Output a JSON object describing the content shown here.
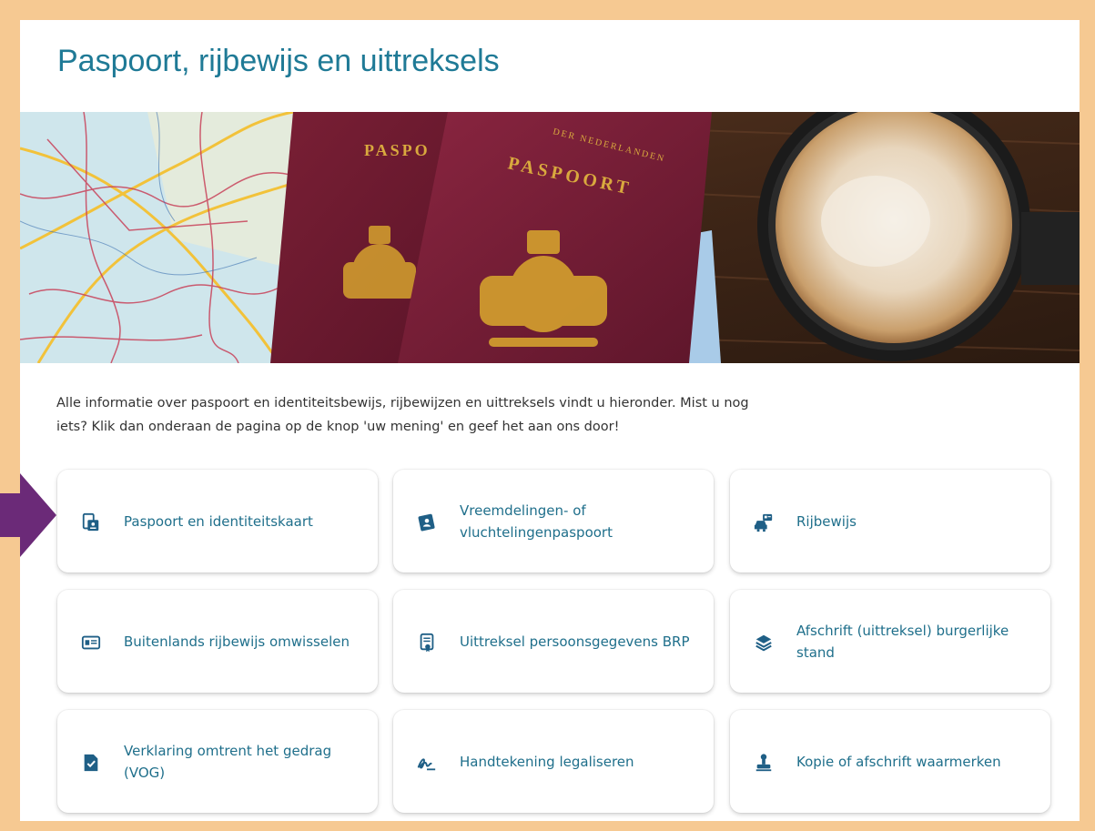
{
  "page": {
    "title": "Paspoort, rijbewijs en uittreksels",
    "intro": "Alle informatie over paspoort en identiteitsbewijs, rijbewijzen en uittreksels vindt u hieronder. Mist u nog iets? Klik dan onderaan de pagina op de knop 'uw mening' en geef het aan ons door!"
  },
  "hero": {
    "passport_text": "PASPOORT",
    "passport_text_back": "PASPO",
    "passport_header": "DER NEDERLANDEN"
  },
  "cards": [
    {
      "label": "Paspoort en identiteitskaart",
      "icon": "passport-icon"
    },
    {
      "label": "Vreemdelingen- of vluchtelingenpaspoort",
      "icon": "id-card-icon"
    },
    {
      "label": "Rijbewijs",
      "icon": "car-license-icon"
    },
    {
      "label": "Buitenlands rijbewijs omwisselen",
      "icon": "license-card-icon"
    },
    {
      "label": "Uittreksel persoonsgegevens BRP",
      "icon": "document-certificate-icon"
    },
    {
      "label": "Afschrift (uittreksel) burgerlijke stand",
      "icon": "layers-icon"
    },
    {
      "label": "Verklaring omtrent het gedrag (VOG)",
      "icon": "checked-document-icon"
    },
    {
      "label": "Handtekening legaliseren",
      "icon": "signature-icon"
    },
    {
      "label": "Kopie of afschrift waarmerken",
      "icon": "stamp-icon"
    }
  ],
  "colors": {
    "frame": "#f6c992",
    "accent": "#1f7a96",
    "link": "#1f6f8b",
    "arrow": "#6b2a78"
  }
}
